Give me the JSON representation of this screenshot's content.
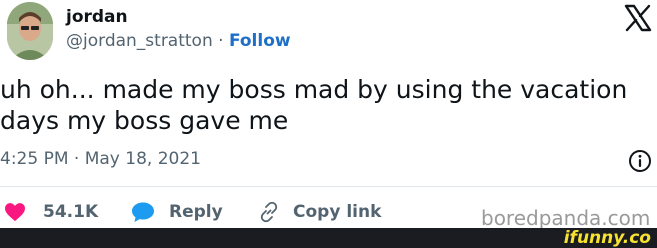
{
  "author": {
    "display_name": "jordan",
    "handle": "@jordan_stratton",
    "separator": "·",
    "follow_label": "Follow"
  },
  "tweet": {
    "text": "uh oh... made my boss mad by using the vacation days my boss gave me",
    "timestamp": "4:25 PM · May 18, 2021"
  },
  "actions": {
    "likes": "54.1K",
    "reply_label": "Reply",
    "copy_link_label": "Copy link"
  },
  "watermarks": {
    "boredpanda": "boredpanda.com",
    "ifunny": "ifunny.co"
  },
  "colors": {
    "like": "#f91880",
    "reply": "#1d9bf0",
    "follow": "#1d6fc9",
    "ifunny": "#f7e32f"
  },
  "icons": [
    "x-logo-icon",
    "info-icon",
    "heart-icon",
    "speech-bubble-icon",
    "link-icon"
  ]
}
